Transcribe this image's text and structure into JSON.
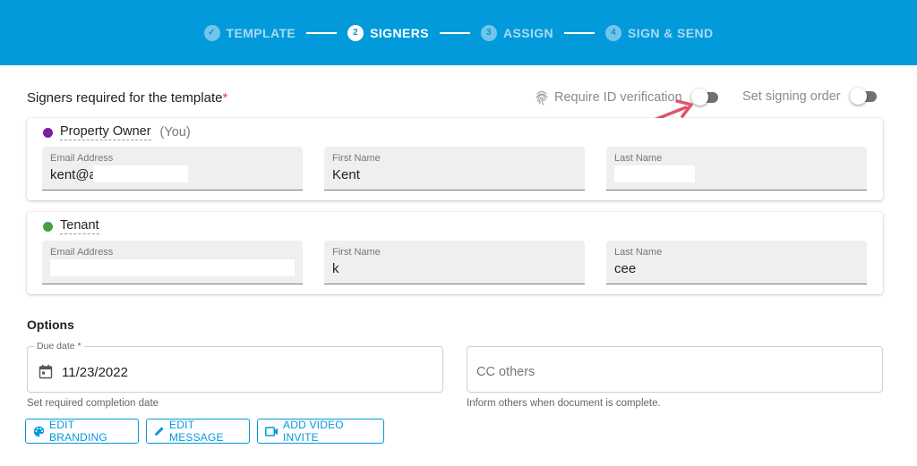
{
  "stepper": {
    "steps": [
      {
        "badge": "✓",
        "label": "TEMPLATE"
      },
      {
        "badge": "2",
        "label": "SIGNERS"
      },
      {
        "badge": "3",
        "label": "ASSIGN"
      },
      {
        "badge": "4",
        "label": "SIGN & SEND"
      }
    ],
    "active_step": "SIGNERS"
  },
  "signers_section": {
    "title": "Signers required for the template",
    "required_mark": "*",
    "require_id": {
      "label": "Require ID verification",
      "on": false
    },
    "signing_order": {
      "label": "Set signing order",
      "on": false
    }
  },
  "signers": [
    {
      "role": "Property Owner",
      "suffix": "(You)",
      "dot_color": "#7b1fa2",
      "email": {
        "label": "Email Address",
        "value": "kent@a"
      },
      "first_name": {
        "label": "First Name",
        "value": "Kent"
      },
      "last_name": {
        "label": "Last Name",
        "value": ""
      }
    },
    {
      "role": "Tenant",
      "suffix": "",
      "dot_color": "#43a047",
      "email": {
        "label": "Email Address",
        "value": ""
      },
      "first_name": {
        "label": "First Name",
        "value": "k"
      },
      "last_name": {
        "label": "Last Name",
        "value": "cee"
      }
    }
  ],
  "options": {
    "title": "Options",
    "due_date": {
      "label": "Due date *",
      "value": "11/23/2022",
      "helper": "Set required completion date"
    },
    "cc_others": {
      "placeholder": "CC others",
      "helper": "Inform others when document is complete."
    }
  },
  "buttons": {
    "edit_branding": "EDIT BRANDING",
    "edit_message": "EDIT MESSAGE",
    "add_video_invite": "ADD VIDEO INVITE"
  },
  "colors": {
    "brand": "#039adb",
    "required": "#e53935",
    "annotation_arrow": "#e0546a"
  }
}
